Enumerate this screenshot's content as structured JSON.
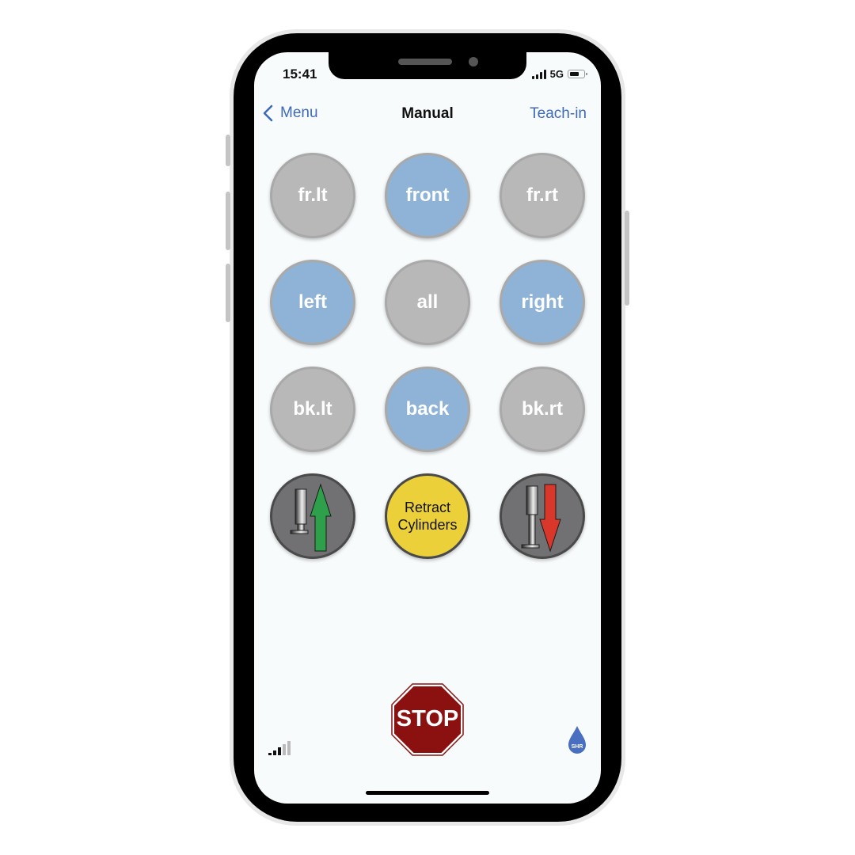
{
  "status_bar": {
    "time": "15:41",
    "network": "5G"
  },
  "nav": {
    "back_label": "Menu",
    "title": "Manual",
    "right_label": "Teach-in"
  },
  "grid": [
    {
      "label": "fr.lt",
      "state": "inactive"
    },
    {
      "label": "front",
      "state": "active"
    },
    {
      "label": "fr.rt",
      "state": "inactive"
    },
    {
      "label": "left",
      "state": "active"
    },
    {
      "label": "all",
      "state": "inactive"
    },
    {
      "label": "right",
      "state": "active"
    },
    {
      "label": "bk.lt",
      "state": "inactive"
    },
    {
      "label": "back",
      "state": "active"
    },
    {
      "label": "bk.rt",
      "state": "inactive"
    }
  ],
  "actions": {
    "extend_icon": "cylinder-up-icon",
    "retract_label_1": "Retract",
    "retract_label_2": "Cylinders",
    "lower_icon": "cylinder-down-icon"
  },
  "stop": {
    "label": "STOP"
  },
  "footer": {
    "connection_signal_bars": 3,
    "connection_signal_max": 5,
    "logo_text": "SHR"
  },
  "colors": {
    "accent": "#3f6ab8",
    "active": "#8fb3d6",
    "inactive": "#b8b8b9",
    "retract": "#ecd03a",
    "stop": "#8b1111",
    "up_arrow": "#2ea04b",
    "down_arrow": "#d9372a"
  }
}
